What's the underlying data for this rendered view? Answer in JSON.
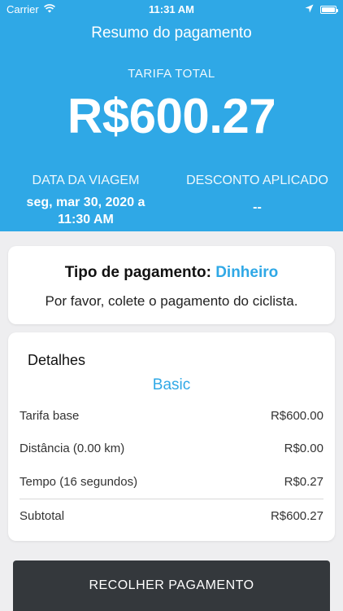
{
  "status_bar": {
    "carrier": "Carrier",
    "time": "11:31 AM",
    "icons": [
      "wifi-icon",
      "location-arrow-icon",
      "battery-icon"
    ]
  },
  "header": {
    "title": "Resumo do pagamento",
    "fare_label": "TARIFA TOTAL",
    "fare_amount": "R$600.27",
    "trip_date_label": "DATA DA VIAGEM",
    "trip_date_line1": "seg, mar 30, 2020 a",
    "trip_date_line2": "11:30 AM",
    "discount_label": "DESCONTO APLICADO",
    "discount_value": "--"
  },
  "payment": {
    "type_label": "Tipo de pagamento:",
    "type_value": "Dinheiro",
    "message": "Por favor, colete o pagamento do ciclista."
  },
  "details": {
    "title": "Detalhes",
    "plan": "Basic",
    "rows": [
      {
        "label": "Tarifa base",
        "value": "R$600.00"
      },
      {
        "label": "Distância (0.00 km)",
        "value": "R$0.00"
      },
      {
        "label": "Tempo (16 segundos)",
        "value": "R$0.27"
      },
      {
        "label": "Subtotal",
        "value": "R$600.27"
      }
    ]
  },
  "action": {
    "collect_label": "RECOLHER PAGAMENTO"
  },
  "colors": {
    "accent": "#2fa8e6",
    "button": "#34383c",
    "background": "#eeeef0"
  }
}
